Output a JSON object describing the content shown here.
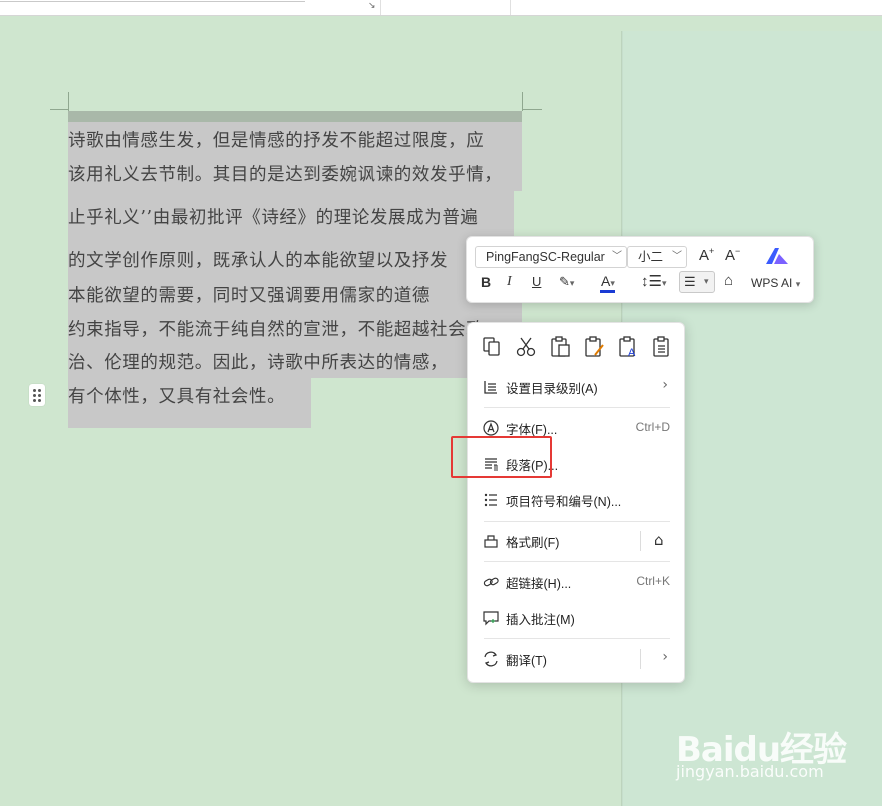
{
  "document": {
    "lines": [
      "诗歌由情感生发，但是情感的抒发不能超过限度，应",
      "该用礼义去节制。其目的是达到委婉讽谏的效发乎情，",
      "止乎礼义’’由最初批评《诗经》的理论发展成为普遍",
      "的文学创作原则，既承认人的本能欲望以及抒发",
      "本能欲望的需要，同时又强调要用儒家的道德",
      "约束指导，不能流于纯自然的宣泄，不能超越社会政",
      "治、伦理的规范。因此，诗歌中所表达的情感，",
      "有个体性，又具有社会性。"
    ]
  },
  "mini_toolbar": {
    "font_name": "PingFangSC-Regular",
    "font_size": "小二",
    "wps_ai_label": "WPS AI",
    "icons": [
      "grow-font-icon",
      "shrink-font-icon",
      "wps-ai-logo-icon",
      "bold-icon",
      "italic-icon",
      "underline-icon",
      "highlight-icon",
      "font-color-icon",
      "line-spacing-icon",
      "align-icon",
      "format-painter-icon"
    ],
    "font_color": "#1565c0",
    "highlight_color": "#e53935"
  },
  "context_menu": {
    "quick_icons": [
      "copy-icon",
      "cut-icon",
      "paste-icon",
      "paste-keep-format-icon",
      "paste-text-only-icon",
      "paste-special-icon"
    ],
    "items": [
      {
        "label": "设置目录级别(A)",
        "shortcut": "",
        "icon": "toc-level-icon"
      },
      {
        "label": "字体(F)...",
        "shortcut": "Ctrl+D",
        "icon": "font-icon"
      },
      {
        "label": "段落(P)...",
        "shortcut": "",
        "icon": "paragraph-icon"
      },
      {
        "label": "项目符号和编号(N)...",
        "shortcut": "",
        "icon": "bullets-icon"
      },
      {
        "label": "格式刷(F)",
        "shortcut": "",
        "icon": "format-painter-icon"
      },
      {
        "label": "超链接(H)...",
        "shortcut": "Ctrl+K",
        "icon": "link-icon"
      },
      {
        "label": "插入批注(M)",
        "shortcut": "",
        "icon": "comment-icon"
      },
      {
        "label": "翻译(T)",
        "shortcut": "",
        "icon": "translate-icon"
      }
    ],
    "highlight_color": "#e53935"
  },
  "watermark": {
    "logo": "Baidu经验",
    "url": "jingyan.baidu.com"
  }
}
